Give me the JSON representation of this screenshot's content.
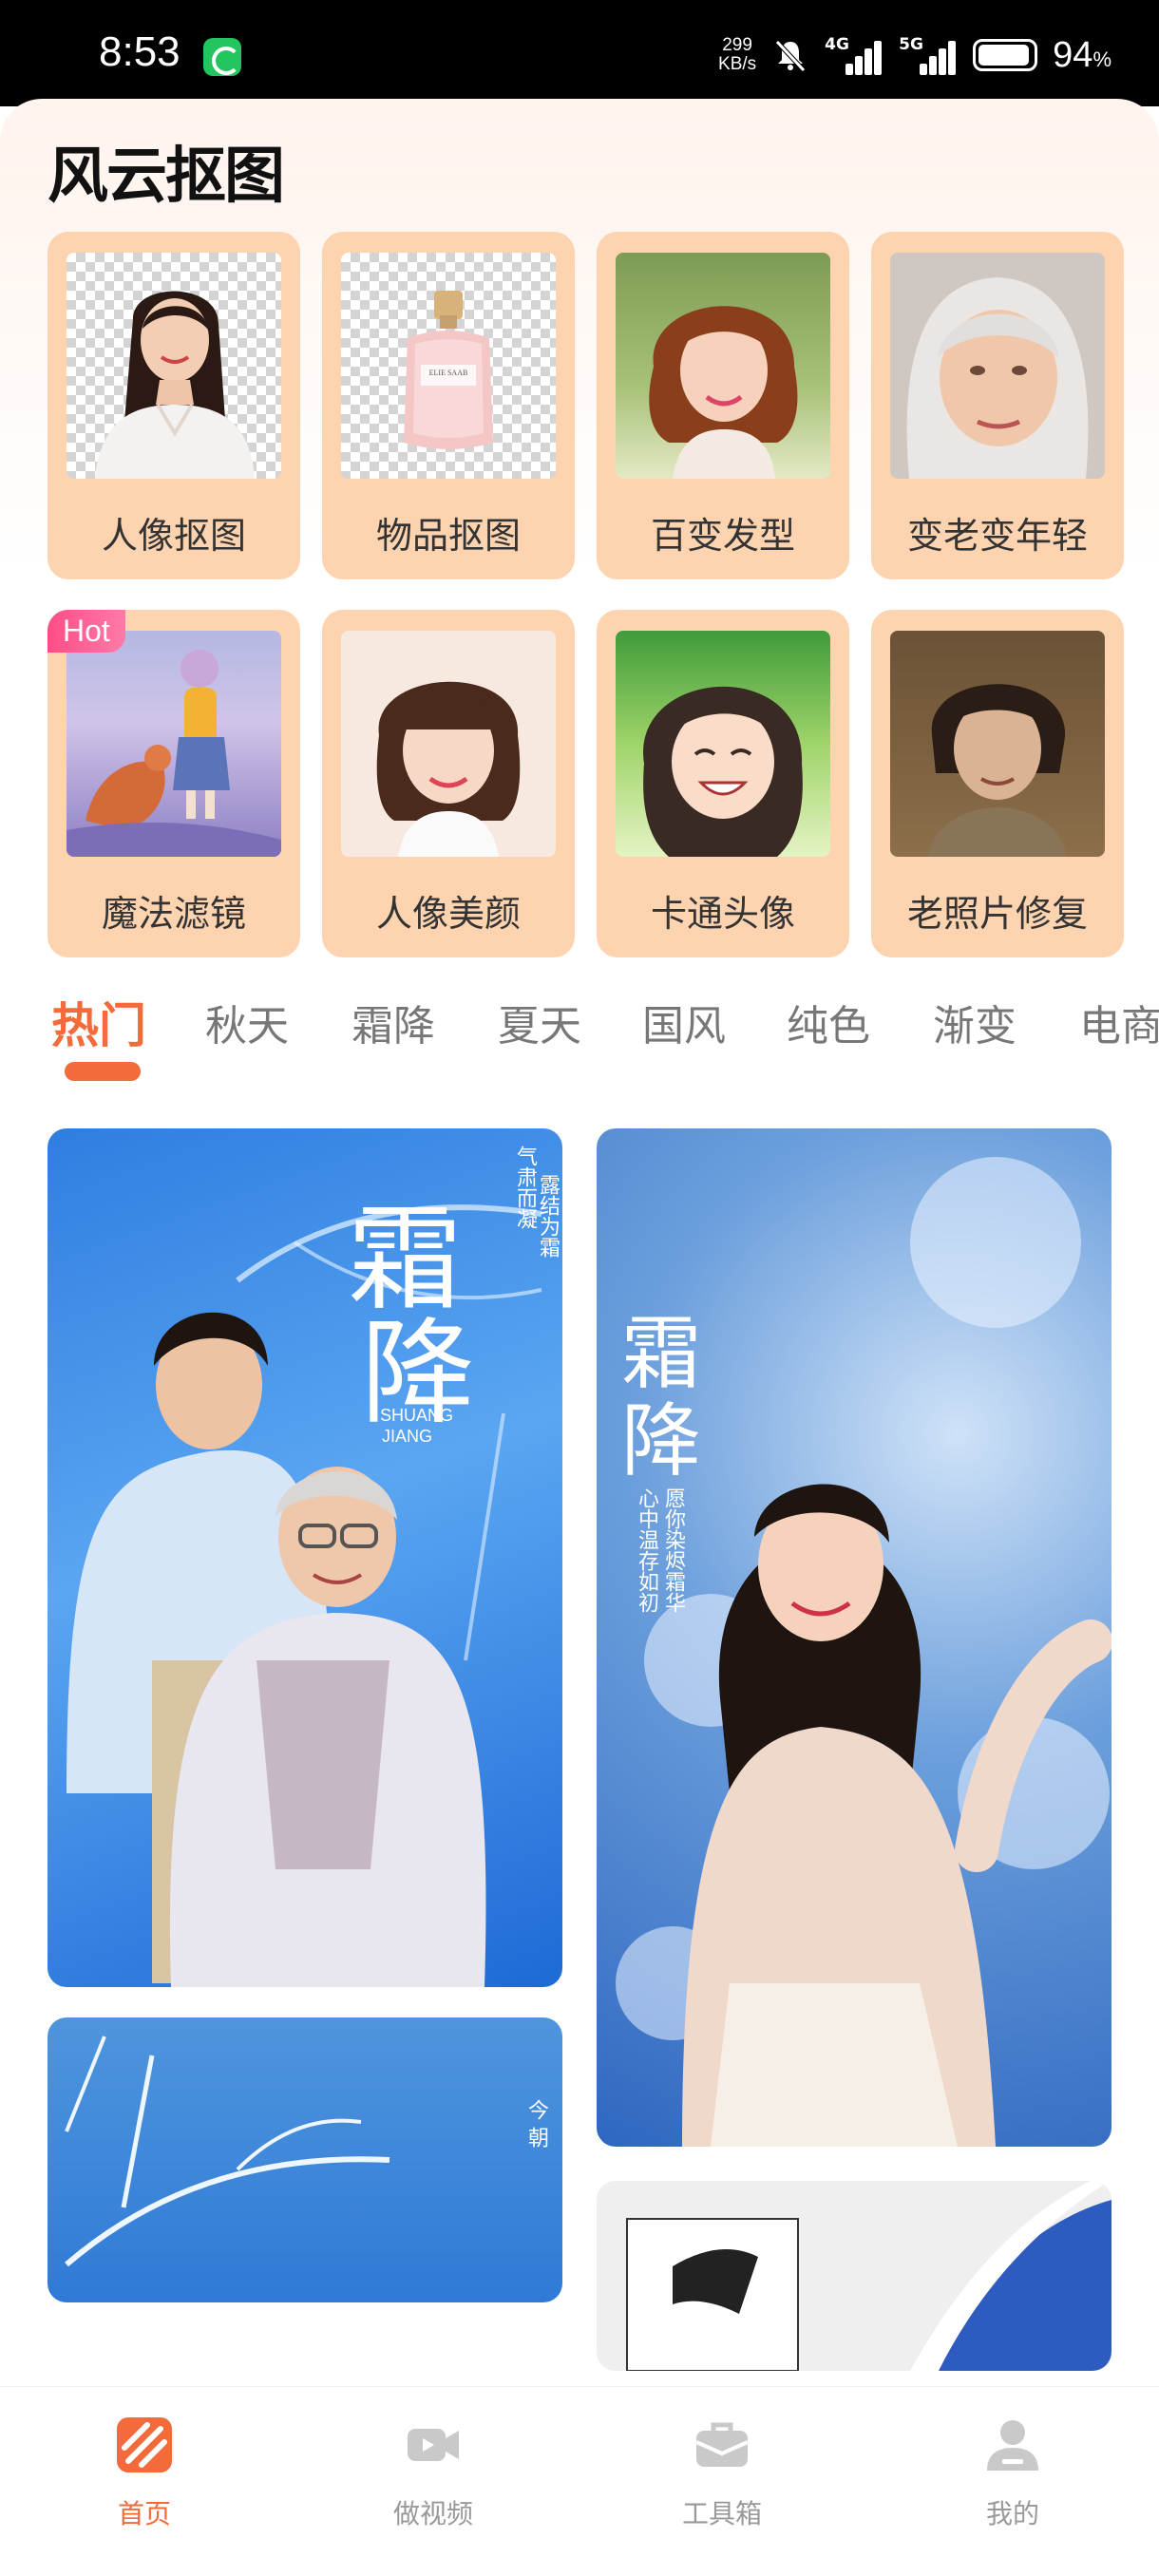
{
  "status_bar": {
    "time": "8:53",
    "net_speed_value": "299",
    "net_speed_unit": "KB/s",
    "signal1_gen": "4G",
    "signal2_gen": "5G",
    "battery_value": "94",
    "battery_unit": "%"
  },
  "app": {
    "title": "风云抠图"
  },
  "tools": [
    {
      "label": "人像抠图"
    },
    {
      "label": "物品抠图"
    },
    {
      "label": "百变发型"
    },
    {
      "label": "变老变年轻"
    },
    {
      "label": "魔法滤镜",
      "badge": "Hot"
    },
    {
      "label": "人像美颜"
    },
    {
      "label": "卡通头像"
    },
    {
      "label": "老照片修复"
    }
  ],
  "product_text": "ELIE SAAB",
  "category_tabs": [
    "热门",
    "秋天",
    "霜降",
    "夏天",
    "国风",
    "纯色",
    "渐变",
    "电商"
  ],
  "posters": {
    "left_title_1": "霜",
    "left_title_2": "降",
    "left_pinyin_1": "SHUANG",
    "left_pinyin_2": "JIANG",
    "left_sub_1": "气肃而凝",
    "left_sub_2": "露结为霜",
    "right_title_1": "霜",
    "right_title_2": "降",
    "right_verse_1": "愿你染烬霜华",
    "right_verse_2": "心中温存如初",
    "bottom_left_text": "今 朝"
  },
  "bottom_nav": [
    {
      "label": "首页"
    },
    {
      "label": "做视频"
    },
    {
      "label": "工具箱"
    },
    {
      "label": "我的"
    }
  ],
  "colors": {
    "accent": "#f36b3a",
    "card_bg": "#fdd3b0",
    "hot_badge": "#ff4d86"
  }
}
